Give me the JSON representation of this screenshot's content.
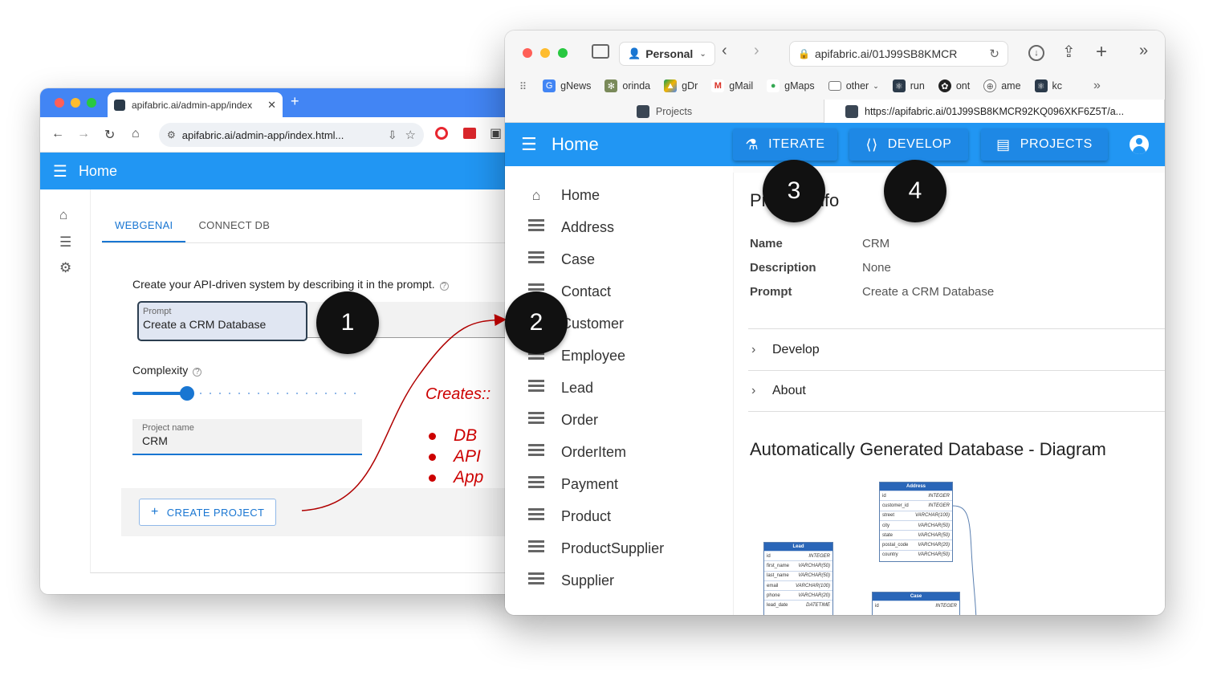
{
  "left_window": {
    "tab_title": "apifabric.ai/admin-app/index",
    "url": "apifabric.ai/admin-app/index.html...",
    "app_title": "Home",
    "tabs": [
      "WEBGENAI",
      "CONNECT DB"
    ],
    "hint": "Create your API-driven system by describing it in the prompt.",
    "prompt": {
      "label": "Prompt",
      "value": "Create a CRM Database"
    },
    "complexity_label": "Complexity",
    "complexity_level": 0.24,
    "project_name": {
      "label": "Project name",
      "value": "CRM"
    },
    "create_button": "CREATE PROJECT"
  },
  "annotations": {
    "badges": [
      "1",
      "2",
      "3",
      "4"
    ],
    "creates_title": "Creates::",
    "creates_items": [
      "DB",
      "API",
      "App"
    ],
    "colors": {
      "accent": "#cc0000",
      "badge": "#111111"
    }
  },
  "right_window": {
    "profile": "Personal",
    "url": "apifabric.ai/01J99SB8KMCR",
    "bookmarks": [
      "gNews",
      "orinda",
      "gDr",
      "gMail",
      "gMaps",
      "other",
      "run",
      "ont",
      "ame",
      "kc"
    ],
    "browser_tabs": [
      "Projects",
      "https://apifabric.ai/01J99SB8KMCR92KQ096XKF6Z5T/a..."
    ],
    "app_title": "Home",
    "nav": {
      "iterate": "ITERATE",
      "develop": "DEVELOP",
      "projects": "PROJECTS"
    },
    "sidebar": [
      "Home",
      "Address",
      "Case",
      "Contact",
      "Customer",
      "Employee",
      "Lead",
      "Order",
      "OrderItem",
      "Payment",
      "Product",
      "ProductSupplier",
      "Supplier"
    ],
    "card_title": "Project Info",
    "info": [
      {
        "key": "Name",
        "value": "CRM"
      },
      {
        "key": "Description",
        "value": "None"
      },
      {
        "key": "Prompt",
        "value": "Create a CRM Database"
      }
    ],
    "expanders": [
      "Develop",
      "About"
    ],
    "diagram_title": "Automatically Generated Database - Diagram",
    "diagram": {
      "address": {
        "name": "Address",
        "rows": [
          [
            "id",
            "INTEGER"
          ],
          [
            "customer_id",
            "INTEGER"
          ],
          [
            "street",
            "VARCHAR(100)"
          ],
          [
            "city",
            "VARCHAR(50)"
          ],
          [
            "state",
            "VARCHAR(50)"
          ],
          [
            "postal_code",
            "VARCHAR(20)"
          ],
          [
            "country",
            "VARCHAR(50)"
          ]
        ]
      },
      "lead": {
        "name": "Lead",
        "rows": [
          [
            "id",
            "INTEGER"
          ],
          [
            "first_name",
            "VARCHAR(50)"
          ],
          [
            "last_name",
            "VARCHAR(50)"
          ],
          [
            "email",
            "VARCHAR(100)"
          ],
          [
            "phone",
            "VARCHAR(20)"
          ],
          [
            "lead_date",
            "DATETIME"
          ]
        ]
      },
      "case": {
        "name": "Case",
        "rows": [
          [
            "id",
            "INTEGER"
          ]
        ]
      }
    },
    "colors": {
      "appbar": "#2196f3",
      "nav_button": "#1e88e5"
    }
  }
}
